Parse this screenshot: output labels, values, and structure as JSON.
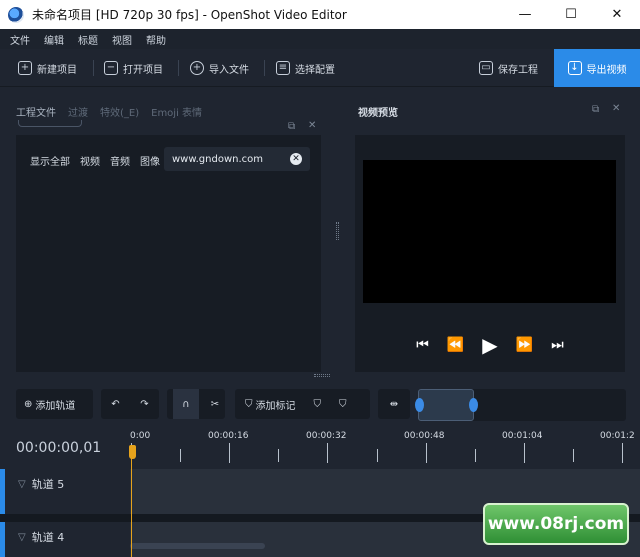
{
  "window": {
    "title": "未命名项目 [HD 720p 30 fps] - OpenShot Video Editor",
    "minimize": "—",
    "maximize": "☐",
    "close": "✕"
  },
  "menu": [
    "文件",
    "编辑",
    "标题",
    "视图",
    "帮助"
  ],
  "toolbar": {
    "new_project": "新建项目",
    "open_project": "打开项目",
    "import_files": "导入文件",
    "choose_profile": "选择配置",
    "save_project": "保存工程",
    "export_video": "导出视频"
  },
  "left_dock": {
    "tabs": [
      "工程文件",
      "过渡",
      "特效(_E)",
      "Emoji 表情"
    ],
    "filters": [
      "显示全部",
      "视频",
      "音频",
      "图像"
    ],
    "search_value": "www.gndown.com"
  },
  "preview": {
    "title": "视频预览"
  },
  "timeline_toolbar": {
    "add_track": "添加轨道",
    "add_marker": "添加标记"
  },
  "timeline": {
    "timecode": "00:00:00,01",
    "ticks": [
      "0:00",
      "00:00:16",
      "00:00:32",
      "00:00:48",
      "00:01:04",
      "00:01:2"
    ]
  },
  "tracks": [
    {
      "name": "轨道 5"
    },
    {
      "name": "轨道 4"
    }
  ],
  "watermark": "www.08rj.com",
  "colors": {
    "accent": "#2b8be8",
    "playhead": "#e6a31c",
    "background": "#1f2530",
    "panel": "#171c24"
  }
}
